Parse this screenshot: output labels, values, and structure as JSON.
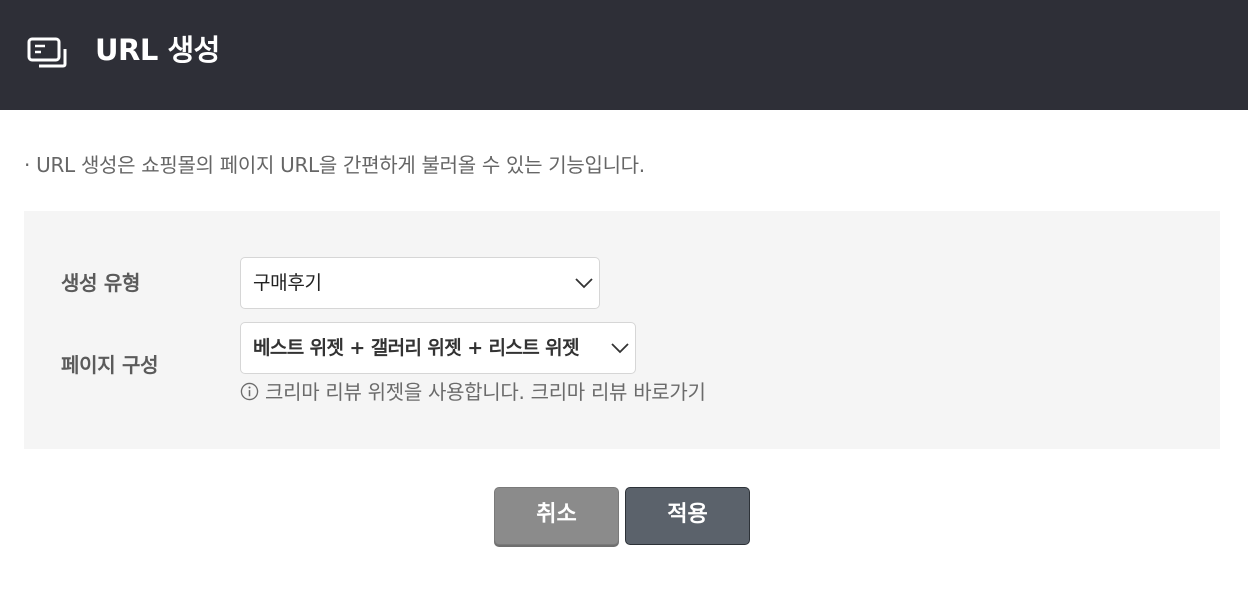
{
  "header": {
    "icon": "window-cards-icon",
    "title": "URL 생성"
  },
  "description": "· URL 생성은 쇼핑몰의 페이지 URL을 간편하게 불러올 수 있는 기능입니다.",
  "form": {
    "type_label": "생성 유형",
    "type_value": "구매후기",
    "page_label": "페이지 구성",
    "page_value": "베스트 위젯 + 갤러리 위젯 + 리스트 위젯",
    "info_icon": "info-circle-icon",
    "info_text": "크리마 리뷰 위젯을 사용합니다.",
    "info_link": "크리마 리뷰 바로가기"
  },
  "buttons": {
    "cancel": "취소",
    "apply": "적용"
  },
  "colors": {
    "header_bg": "#2e2f37",
    "panel_bg": "#f5f5f5",
    "cancel_bg": "#8b8b8b",
    "apply_bg": "#5b626b"
  }
}
